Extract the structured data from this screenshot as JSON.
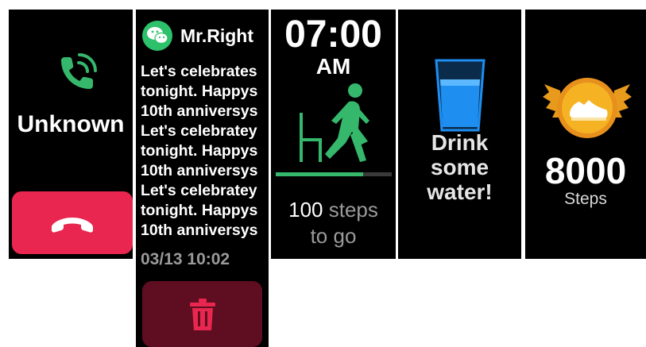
{
  "incoming_call": {
    "caller": "Unknown",
    "icons": {
      "call": "phone-ringing-icon",
      "hangup": "phone-hangup-icon"
    },
    "colors": {
      "call_icon": "#35B86C",
      "hangup_button": "#E8264F"
    }
  },
  "message": {
    "app_icon": "wechat-icon",
    "sender": "Mr.Right",
    "lines": [
      "Let's celebrates",
      "tonight. Happys",
      "10th anniversys",
      "Let's celebratey",
      "tonight. Happys",
      "10th anniversys",
      "Let's celebratey",
      "tonight. Happys",
      "10th anniversys"
    ],
    "timestamp": "03/13 10:02",
    "delete_icon": "trash-icon",
    "colors": {
      "app_icon": "#2DC16B",
      "delete_button": "#5E0E20",
      "delete_icon": "#E8264F"
    }
  },
  "activity": {
    "time": "07:00",
    "ampm": "AM",
    "icon": "walking-person-icon",
    "progress": 0.75,
    "steps_value": "100",
    "steps_text1": " steps",
    "steps_text2": "to go",
    "colors": {
      "accent": "#35B86C"
    }
  },
  "hydration": {
    "icon": "water-glass-icon",
    "text": "Drink\nsome\nwater!",
    "colors": {
      "water": "#1E8EF0"
    }
  },
  "goal": {
    "icon": "shoe-medal-icon",
    "steps": "8000",
    "label": "Steps",
    "colors": {
      "medal": "#F5B324"
    }
  }
}
